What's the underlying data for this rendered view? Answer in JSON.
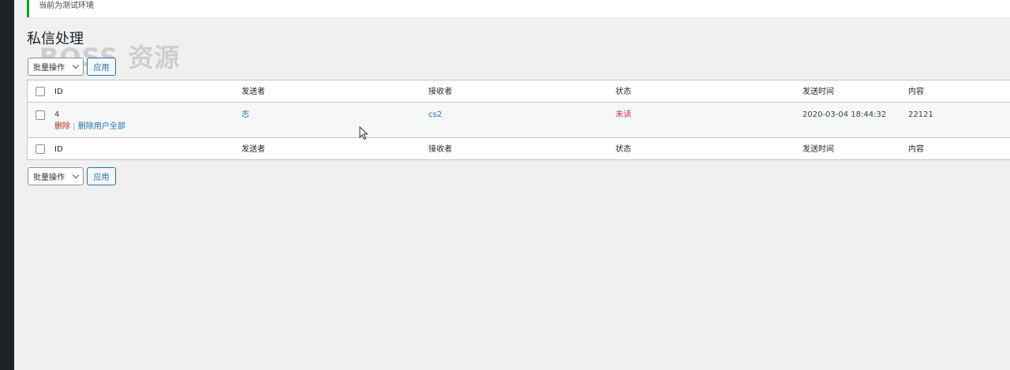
{
  "notice": {
    "text": "当前为测试环境"
  },
  "page": {
    "title": "私信处理",
    "watermark": "BOSS 资源"
  },
  "bulk_actions": {
    "select_label": "批量操作",
    "apply_label": "应用"
  },
  "table": {
    "columns": {
      "id": "ID",
      "sender": "发送者",
      "receiver": "接收者",
      "status": "状态",
      "send_time": "发送时间",
      "content": "内容"
    },
    "rows": [
      {
        "id": "4",
        "sender": "志",
        "receiver": "cs2",
        "status": "未读",
        "send_time": "2020-03-04 18:44:32",
        "content": "22121",
        "actions": {
          "delete": "删除",
          "separator": "|",
          "delete_all": "删除用户全部"
        }
      }
    ]
  },
  "colors": {
    "notice_border": "#00a32a",
    "link": "#2271b1",
    "unread_status": "#d63638",
    "delete_action": "#b32d2e",
    "sidebar": "#1d2327"
  },
  "icons": {
    "select_chevron": "chevron-down-icon",
    "pointer": "mouse-cursor-icon"
  }
}
